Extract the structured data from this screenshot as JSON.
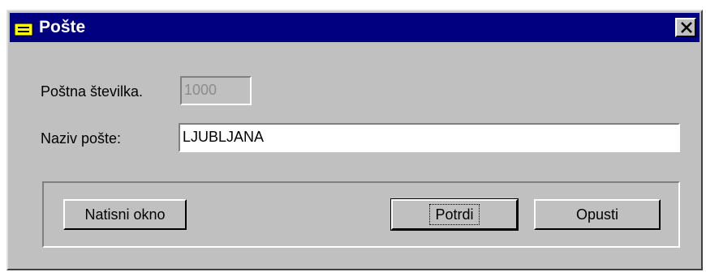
{
  "window": {
    "title": "Pošte",
    "icon": "form-icon"
  },
  "fields": {
    "postal_number_label": "Poštna številka.",
    "postal_number_value": "1000",
    "post_name_label": "Naziv pošte:",
    "post_name_value": "LJUBLJANA"
  },
  "buttons": {
    "print": "Natisni okno",
    "confirm": "Potrdi",
    "cancel": "Opusti"
  },
  "colors": {
    "titlebar": "#000080",
    "face": "#c0c0c0",
    "icon_yellow": "#ffff00"
  }
}
